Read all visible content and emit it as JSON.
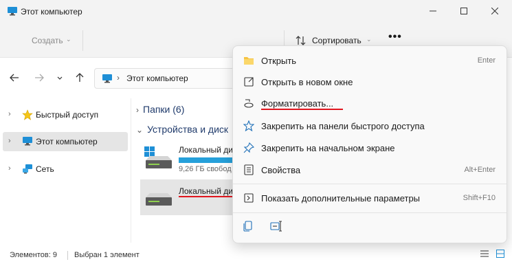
{
  "window": {
    "title": "Этот компьютер",
    "controls": [
      "minimize-icon",
      "maximize-icon",
      "close-icon"
    ]
  },
  "toolbar": {
    "create_label": "Создать",
    "sort_label": "Сортировать",
    "more_label": "•••"
  },
  "address": {
    "location": "Этот компьютер"
  },
  "sidebar": {
    "items": [
      {
        "label": "Быстрый доступ",
        "icon": "star-icon"
      },
      {
        "label": "Этот компьютер",
        "icon": "computer-icon"
      },
      {
        "label": "Сеть",
        "icon": "network-icon"
      }
    ]
  },
  "content": {
    "folders_header": "Папки (6)",
    "devices_header": "Устройства и диск",
    "drives": [
      {
        "name": "Локальный ди",
        "free": "9,26 ГБ свобод",
        "fill": 0.85
      },
      {
        "name": "Локальный ди",
        "free": ""
      }
    ]
  },
  "status": {
    "elements": "Элементов: 9",
    "selected": "Выбран 1 элемент"
  },
  "context_menu": {
    "items": [
      {
        "label": "Открыть",
        "shortcut": "Enter",
        "icon": "folder-icon"
      },
      {
        "label": "Открыть в новом окне",
        "shortcut": "",
        "icon": "new-window-icon"
      },
      {
        "label": "Форматировать...",
        "shortcut": "",
        "icon": "format-icon"
      },
      {
        "label": "Закрепить на панели быстрого доступа",
        "shortcut": "",
        "icon": "pin-icon"
      },
      {
        "label": "Закрепить на начальном экране",
        "shortcut": "",
        "icon": "pin-start-icon"
      },
      {
        "label": "Свойства",
        "shortcut": "Alt+Enter",
        "icon": "properties-icon"
      },
      {
        "label": "Показать дополнительные параметры",
        "shortcut": "Shift+F10",
        "icon": "more-options-icon"
      }
    ],
    "footer_icons": [
      "copy-icon",
      "rename-icon"
    ]
  },
  "colors": {
    "accent": "#26a0da",
    "highlight_underline": "#e0151e",
    "selection": "#e5e5e5"
  }
}
